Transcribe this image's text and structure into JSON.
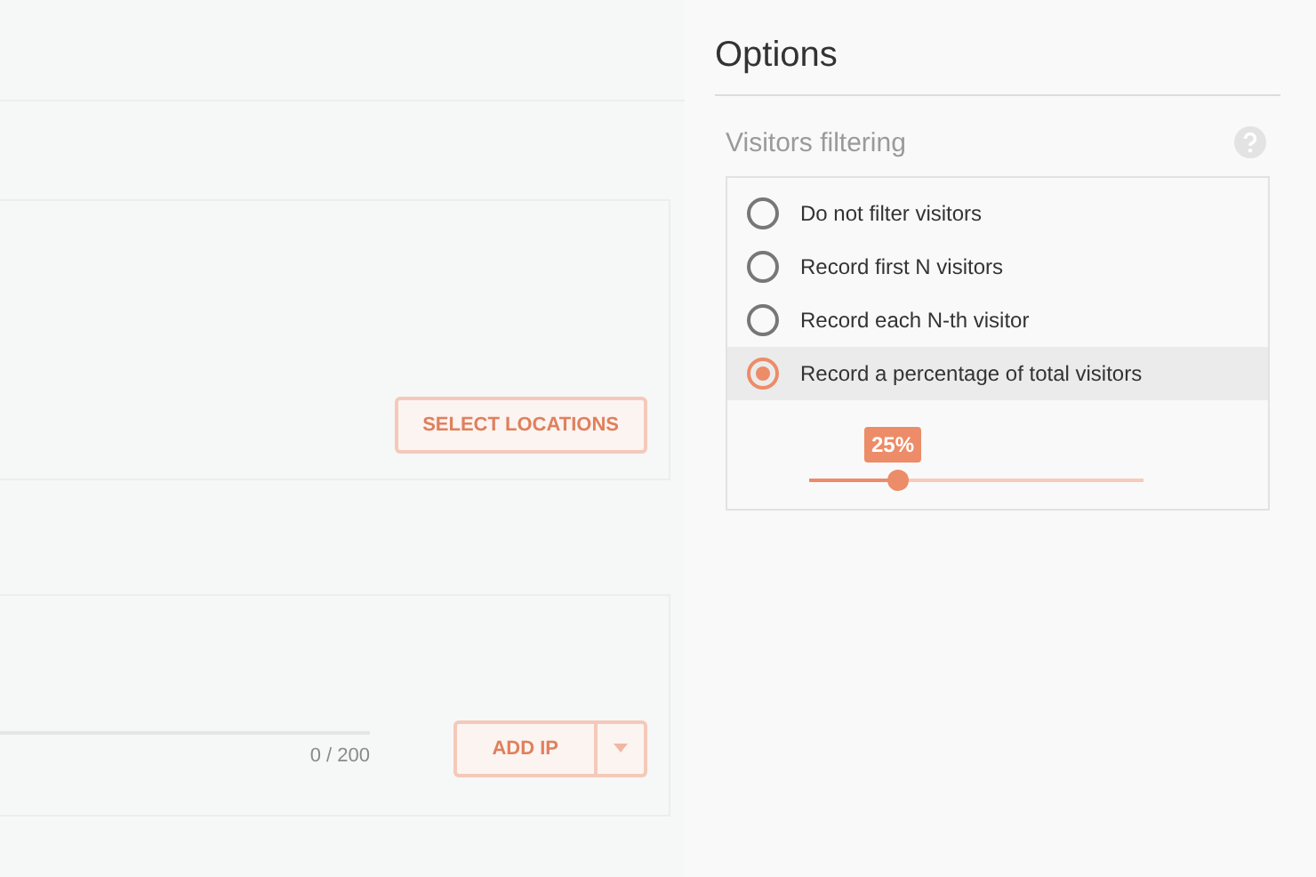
{
  "background": {
    "locations_button": "SELECT LOCATIONS",
    "ip_counter": "0 / 200",
    "add_ip_button": "ADD IP"
  },
  "options": {
    "title": "Options",
    "section": "Visitors filtering",
    "choices": [
      {
        "label": "Do not filter visitors",
        "selected": false
      },
      {
        "label": "Record first N visitors",
        "selected": false
      },
      {
        "label": "Record each N-th visitor",
        "selected": false
      },
      {
        "label": "Record a percentage of total visitors",
        "selected": true
      }
    ],
    "slider": {
      "level": 0.25,
      "reading": "25%"
    }
  }
}
